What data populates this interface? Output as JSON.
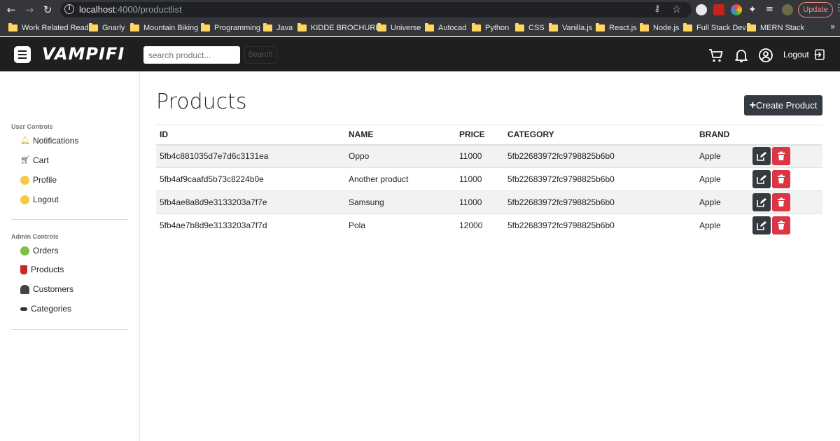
{
  "browser": {
    "url_host": "localhost",
    "url_path": ":4000/productlist",
    "update_label": "Update",
    "bookmarks": [
      "Work Related Reads",
      "Gnarly",
      "Mountain Biking",
      "Programming",
      "Java",
      "KIDDE BROCHURES",
      "Universe",
      "Autocad",
      "Python",
      "CSS",
      "Vanilla.js",
      "React.js",
      "Node.js",
      "Full Stack Dev",
      "MERN Stack"
    ],
    "more_bookmarks": "»"
  },
  "navbar": {
    "brand": "VAMPIFI",
    "search_placeholder": "search product...",
    "search_button": "Search",
    "logout_label": "Logout"
  },
  "sidebar": {
    "user_title": "User Controls",
    "user_items": [
      {
        "label": "Notifications",
        "icon": "bell-icon"
      },
      {
        "label": "Cart",
        "icon": "cart-icon"
      },
      {
        "label": "Profile",
        "icon": "nerd-face-icon"
      },
      {
        "label": "Logout",
        "icon": "face-icon"
      }
    ],
    "admin_title": "Admin Controls",
    "admin_items": [
      {
        "label": "Orders",
        "icon": "money-face-icon"
      },
      {
        "label": "Products",
        "icon": "cup-icon"
      },
      {
        "label": "Customers",
        "icon": "busts-icon"
      },
      {
        "label": "Categories",
        "icon": "stack-icon"
      }
    ]
  },
  "main": {
    "title": "Products",
    "create_button": "Create Product",
    "columns": [
      "ID",
      "NAME",
      "PRICE",
      "CATEGORY",
      "BRAND"
    ],
    "rows": [
      {
        "id": "5fb4c881035d7e7d6c3131ea",
        "name": "Oppo",
        "price": "11000",
        "category": "5fb22683972fc9798825b6b0",
        "brand": "Apple"
      },
      {
        "id": "5fb4af9caafd5b73c8224b0e",
        "name": "Another product",
        "price": "11000",
        "category": "5fb22683972fc9798825b6b0",
        "brand": "Apple"
      },
      {
        "id": "5fb4ae8a8d9e3133203a7f7e",
        "name": "Samsung",
        "price": "11000",
        "category": "5fb22683972fc9798825b6b0",
        "brand": "Apple"
      },
      {
        "id": "5fb4ae7b8d9e3133203a7f7d",
        "name": "Pola",
        "price": "12000",
        "category": "5fb22683972fc9798825b6b0",
        "brand": "Apple"
      }
    ]
  },
  "colors": {
    "navbar_bg": "#1f1f1f",
    "edit_btn": "#343a40",
    "delete_btn": "#dc3545",
    "stripe": "#f2f2f2"
  }
}
